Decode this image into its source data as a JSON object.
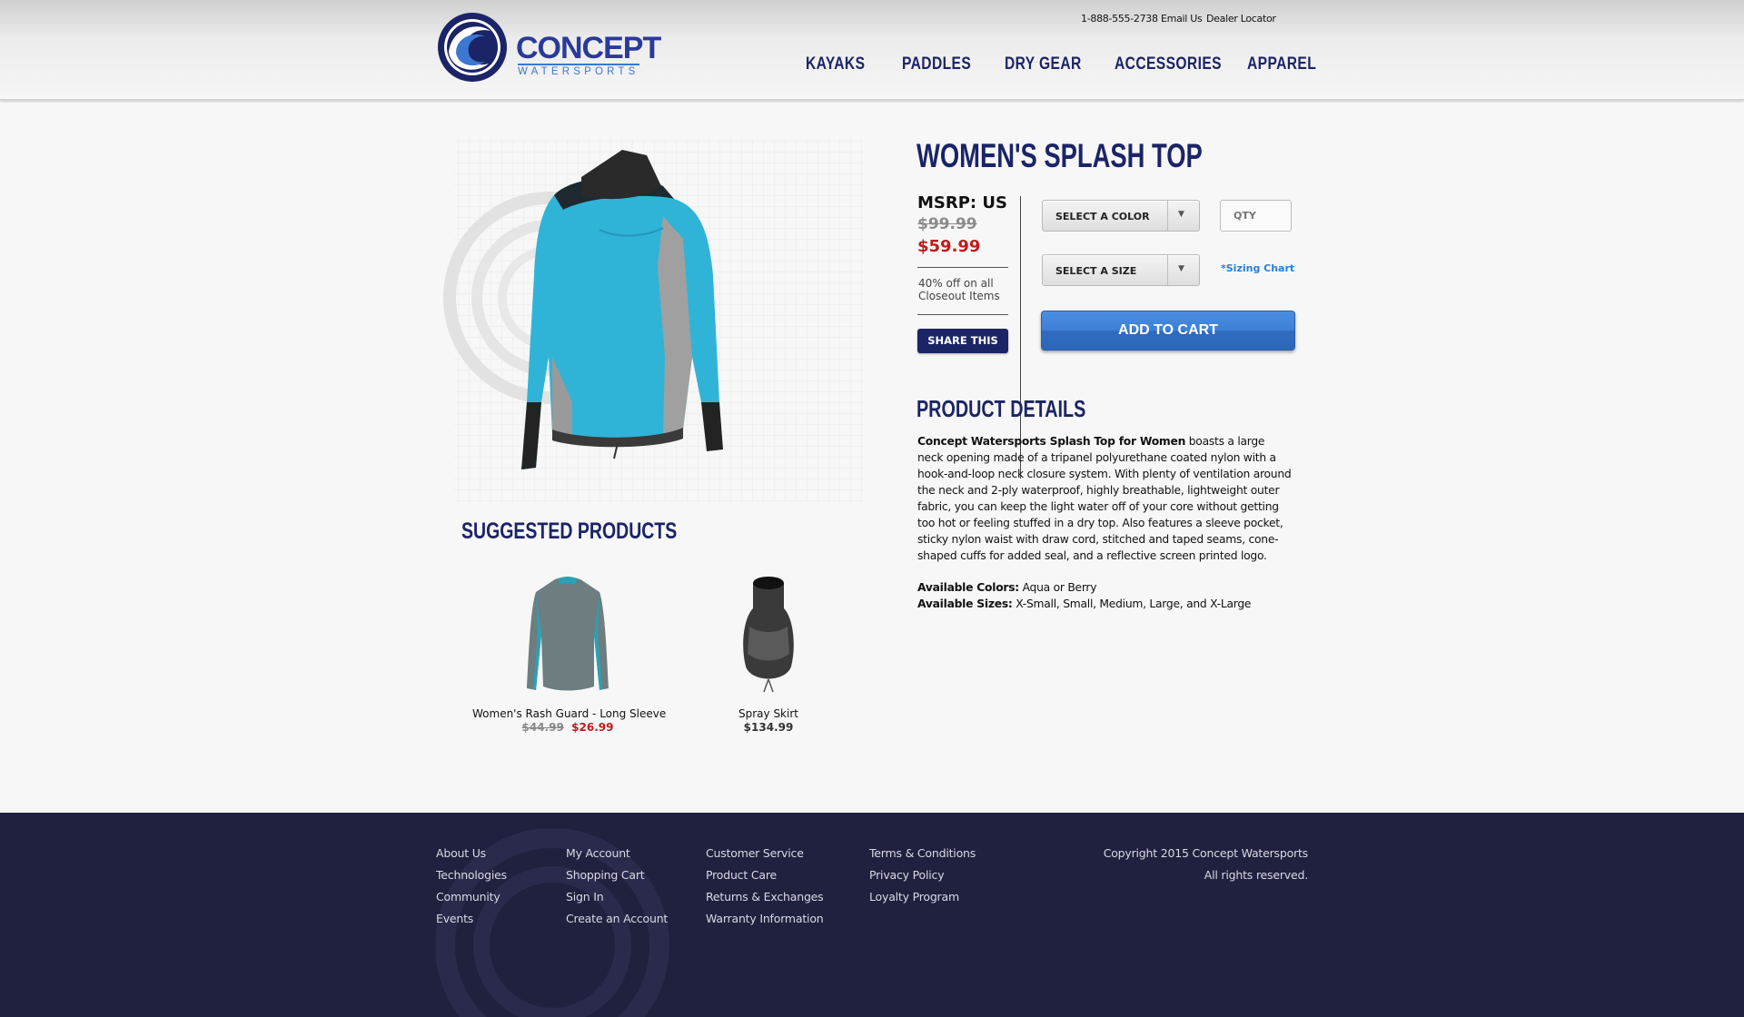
{
  "brand": {
    "name": "CONCEPT",
    "tagline": "WATERSPORTS"
  },
  "utility_links": [
    "1-888-555-2738",
    "Email Us",
    "Dealer Locator"
  ],
  "main_nav": [
    "KAYAKS",
    "PADDLES",
    "DRY GEAR",
    "ACCESSORIES",
    "APPAREL"
  ],
  "product": {
    "title": "WOMEN'S SPLASH TOP",
    "msrp_label": "MSRP: US",
    "price_original": "$99.99",
    "price_sale": "$59.99",
    "promo": "40% off on all Closeout Items",
    "share_label": "SHARE THIS",
    "color_select": "SELECT A COLOR",
    "size_select": "SELECT A SIZE",
    "qty_placeholder": "QTY",
    "sizing_chart": "*Sizing Chart",
    "add_to_cart": "ADD TO CART",
    "colors": {
      "jacket_body": "#2fb4d8",
      "jacket_panel": "#9a9a9a",
      "jacket_collar": "#2a2a2a"
    }
  },
  "details": {
    "title": "PRODUCT DETAILS",
    "lead": "Concept Watersports Splash Top for Women",
    "body": " boasts a large neck opening made of a tripanel polyurethane coated nylon with a hook-and-loop neck closure system. With plenty of ventilation around the neck and 2-ply waterproof, highly breathable, lightweight outer fabric, you can keep the light water off of your core without getting too hot or feeling stuffed in a dry top. Also features a sleeve pocket, sticky nylon waist with draw cord, stitched and taped seams, cone-shaped cuffs for added seal, and a reflective screen printed logo.",
    "colors_label": "Available Colors:",
    "colors_value": " Aqua or Berry",
    "sizes_label": "Available Sizes:",
    "sizes_value": " X-Small, Small, Medium, Large, and X-Large"
  },
  "suggested": {
    "title": "SUGGESTED PRODUCTS",
    "items": [
      {
        "name": "Women's Rash Guard - Long Sleeve",
        "price_original": "$44.99",
        "price_sale": "$26.99"
      },
      {
        "name": "Spray Skirt",
        "price": "$134.99"
      }
    ]
  },
  "footer": {
    "col1": [
      "About Us",
      "Technologies",
      "Community",
      "Events"
    ],
    "col2": [
      "My Account",
      "Shopping Cart",
      "Sign In",
      "Create an Account"
    ],
    "col3": [
      "Customer Service",
      "Product Care",
      "Returns & Exchanges",
      "Warranty Information"
    ],
    "col4": [
      "Terms & Conditions",
      "Privacy Policy",
      "Loyalty Program"
    ],
    "copyright": "Copyright 2015 Concept Watersports",
    "rights": "All rights reserved."
  }
}
